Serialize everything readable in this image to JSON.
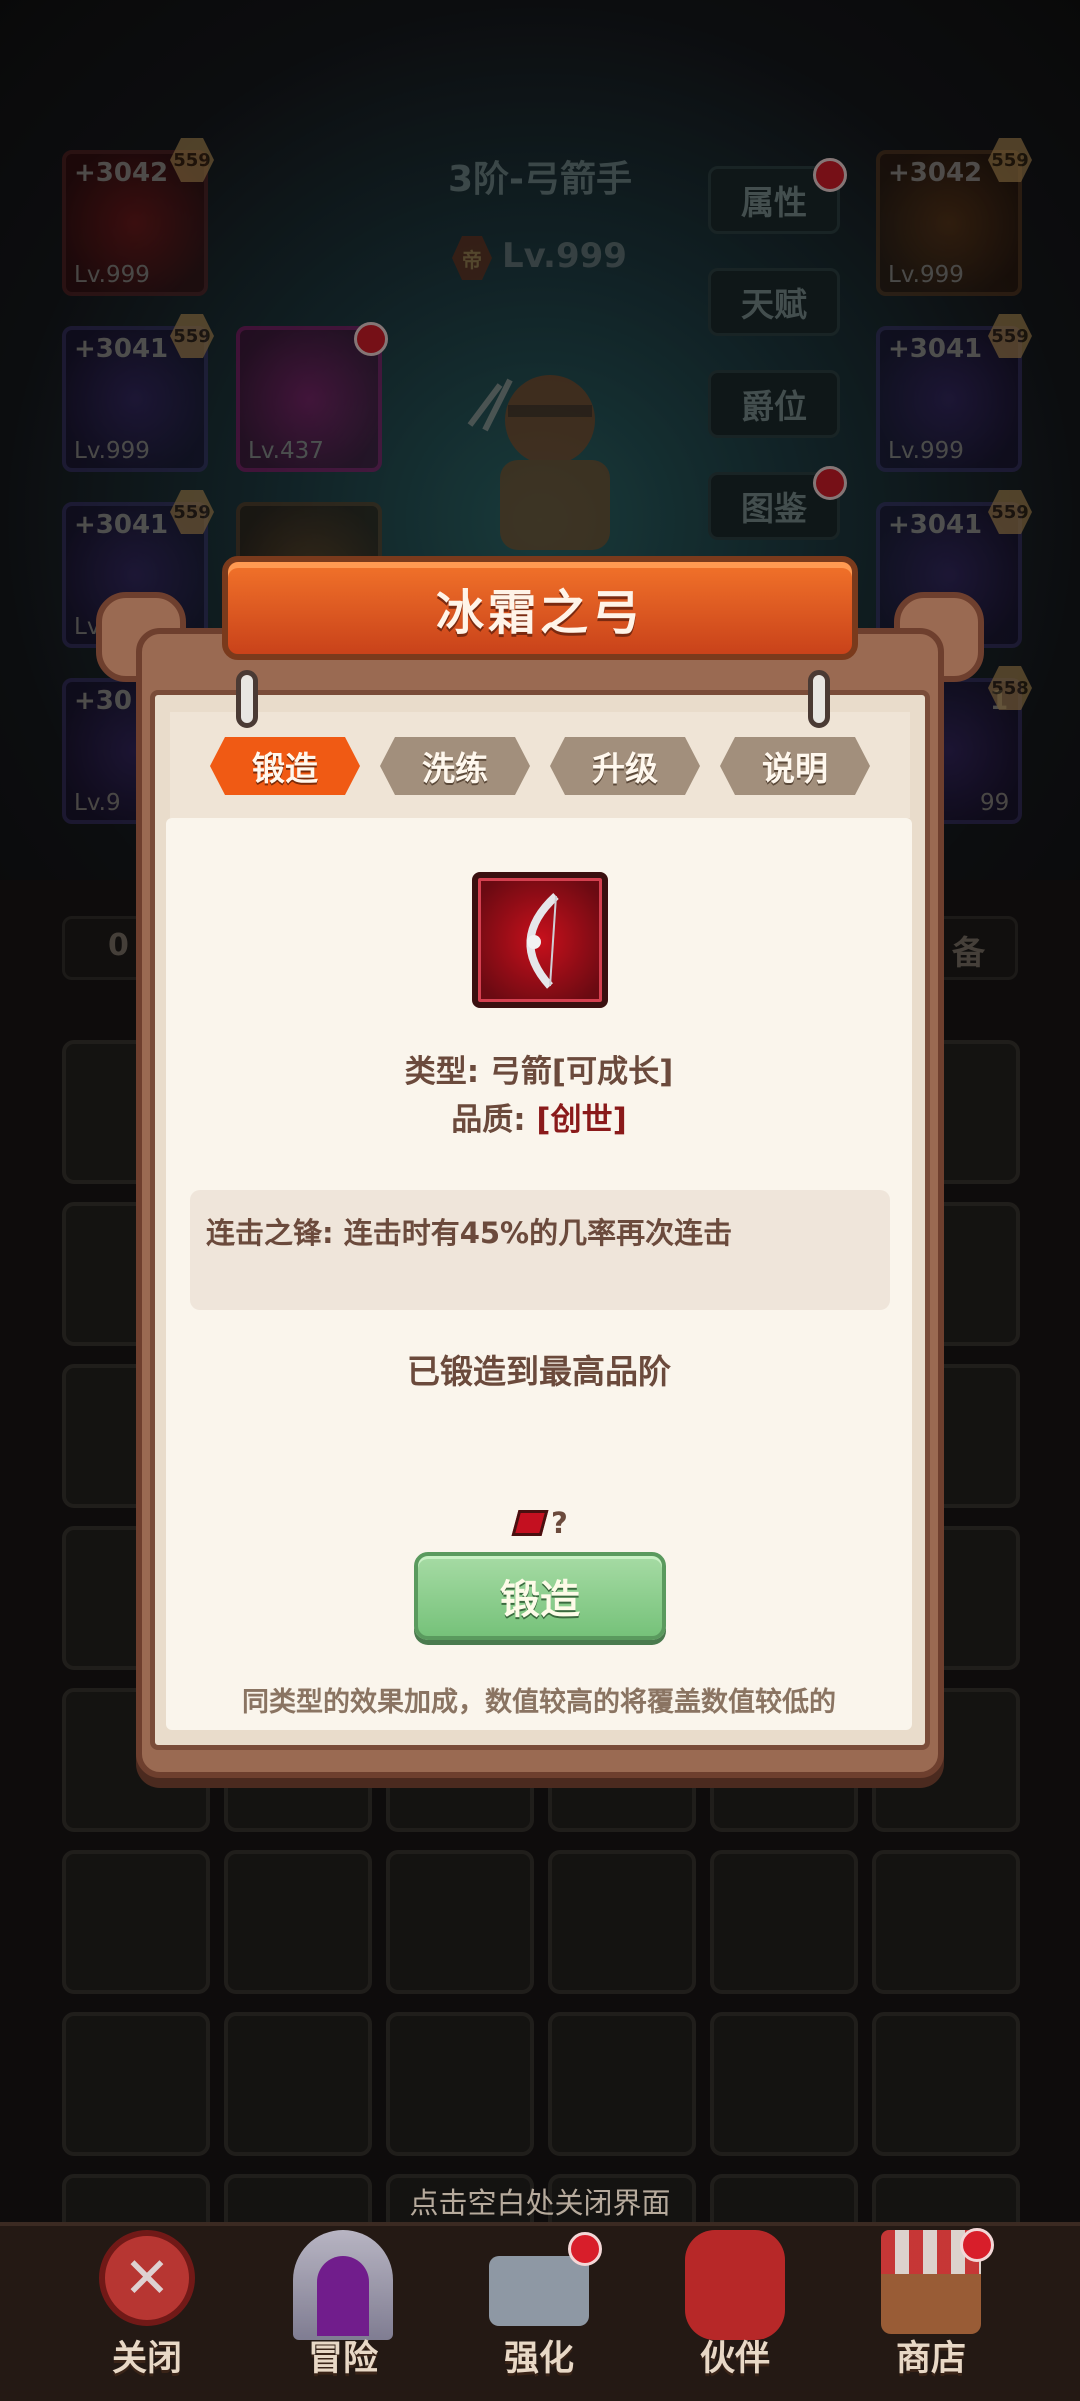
{
  "hero": {
    "title": "3阶-弓箭手",
    "rank_icon_text": "帝",
    "level": "Lv.999"
  },
  "side_menu": [
    "属性",
    "天赋",
    "爵位",
    "图鉴"
  ],
  "equip_slots": {
    "top_left": {
      "plus": "+3042",
      "level": "Lv.999",
      "badge": "559"
    },
    "top_right": {
      "plus": "+3042",
      "level": "Lv.999",
      "badge": "559"
    },
    "mid_left": {
      "plus": "+3041",
      "level": "Lv.999",
      "badge": "559"
    },
    "mid_right": {
      "plus": "+3041",
      "level": "Lv.999",
      "badge": "559"
    },
    "third_left": {
      "plus": "+3041",
      "level": "Lv",
      "badge": "559"
    },
    "third_right": {
      "plus": "+3041",
      "level": "",
      "badge": "559"
    },
    "fourth_left": {
      "plus": "+30",
      "level": "Lv.9",
      "badge": ""
    },
    "fourth_right": {
      "plus": "1",
      "level": "99",
      "badge": "558"
    },
    "ticket": {
      "level": "Lv.437"
    }
  },
  "bag_bar": {
    "left_text": "0",
    "right_text": "备"
  },
  "dialog": {
    "title": "冰霜之弓",
    "tabs": [
      "锻造",
      "洗练",
      "升级",
      "说明"
    ],
    "active_tab": 0,
    "type_label": "类型: 弓箭[可成长]",
    "quality_label": "品质: ",
    "quality_value": "[创世]",
    "effect": "连击之锋: 连击时有45%的几率再次连击",
    "status": "已锻造到最高品阶",
    "cost_text": "?",
    "forge_button": "锻造",
    "footnote": "同类型的效果加成，数值较高的将覆盖数值较低的"
  },
  "close_hint": "点击空白处关闭界面",
  "bottom_nav": [
    "关闭",
    "冒险",
    "强化",
    "伙伴",
    "商店"
  ],
  "colors": {
    "accent_orange": "#f05a14",
    "forge_green": "#76c27a",
    "paper": "#faf5ec",
    "notification_red": "#d81e2a",
    "quality_red": "#8a1a1a"
  }
}
